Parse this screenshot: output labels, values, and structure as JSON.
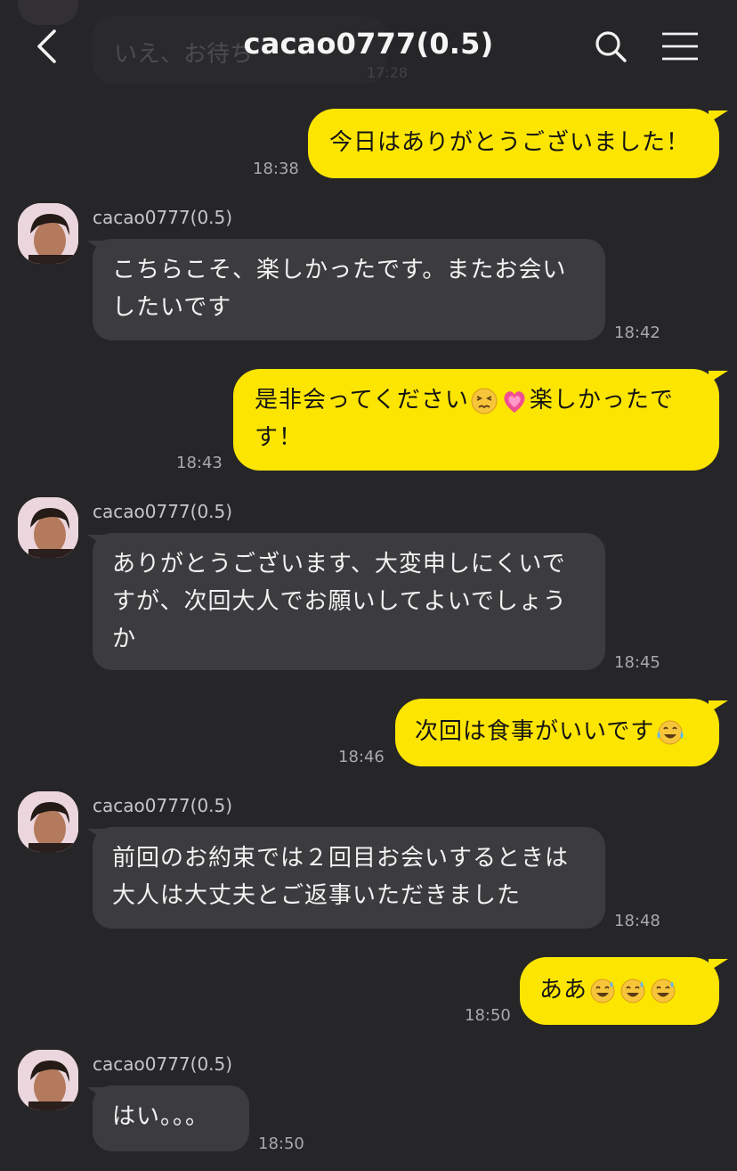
{
  "header": {
    "title": "cacao0777(0.5)",
    "ghost_text": "いえ、お待ち",
    "ghost_time": "17:28"
  },
  "messages": [
    {
      "from": "me",
      "text": "今日はありがとうございました！",
      "time": "18:38"
    },
    {
      "from": "them",
      "name": "cacao0777(0.5)",
      "lines": [
        "こちらこそ、楽しかったです。またお会い",
        "したいです"
      ],
      "time": "18:42"
    },
    {
      "from": "me",
      "lines": [
        "是非会ってください",
        "楽しかったで",
        "す！"
      ],
      "emojis": [
        "persevering-face-emoji",
        "growing-heart-emoji"
      ],
      "time": "18:43"
    },
    {
      "from": "them",
      "name": "cacao0777(0.5)",
      "lines": [
        "ありがとうございます、大変申しにくいで",
        "すが、次回大人でお願いしてよいでしょう",
        "か"
      ],
      "time": "18:45"
    },
    {
      "from": "me",
      "text": "次回は食事がいいです",
      "emojis": [
        "tears-of-joy-emoji"
      ],
      "time": "18:46"
    },
    {
      "from": "them",
      "name": "cacao0777(0.5)",
      "lines": [
        "前回のお約束では２回目お会いするときは",
        "大人は大丈夫とご返事いただきました"
      ],
      "time": "18:48"
    },
    {
      "from": "me",
      "text": "ああ",
      "emojis": [
        "sweat-smile-emoji",
        "sweat-smile-emoji",
        "sweat-smile-emoji"
      ],
      "time": "18:50"
    },
    {
      "from": "them",
      "name": "cacao0777(0.5)",
      "text": "はい。。。",
      "time": "18:50"
    }
  ],
  "colors": {
    "background": "#262528",
    "my_bubble": "#fde502",
    "their_bubble": "#3c3b3e",
    "time_text": "#a9a8ac"
  },
  "icons": {
    "back": "chevron-left-icon",
    "search": "search-icon",
    "menu": "hamburger-menu-icon"
  }
}
